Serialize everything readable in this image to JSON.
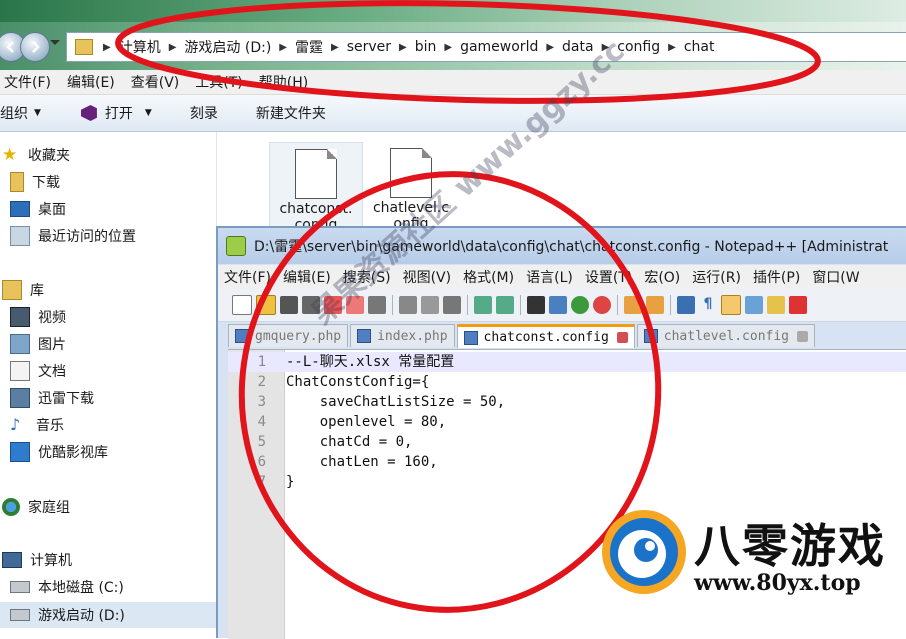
{
  "explorer": {
    "breadcrumb": [
      "计算机",
      "游戏启动 (D:)",
      "雷霆",
      "server",
      "bin",
      "gameworld",
      "data",
      "config",
      "chat"
    ],
    "menu": [
      "文件(F)",
      "编辑(E)",
      "查看(V)",
      "工具(T)",
      "帮助(H)"
    ],
    "toolbar": {
      "organize": "组织",
      "open": "打开",
      "burn": "刻录",
      "new_folder": "新建文件夹"
    },
    "sidebar": {
      "favorites": {
        "label": "收藏夹",
        "items": [
          "下载",
          "桌面",
          "最近访问的位置"
        ]
      },
      "libraries": {
        "label": "库",
        "items": [
          "视频",
          "图片",
          "文档",
          "迅雷下载",
          "音乐",
          "优酷影视库"
        ]
      },
      "homegroup": "家庭组",
      "computer": {
        "label": "计算机",
        "items": [
          "本地磁盘 (C:)",
          "游戏启动 (D:)"
        ]
      }
    },
    "files": [
      {
        "name": "chatconst.",
        "name2": "config"
      },
      {
        "name": "chatlevel.c",
        "name2": "onfig"
      }
    ]
  },
  "notepad": {
    "title": "D:\\雷霆\\server\\bin\\gameworld\\data\\config\\chat\\chatconst.config - Notepad++ [Administrat",
    "menu": [
      "文件(F)",
      "编辑(E)",
      "搜索(S)",
      "视图(V)",
      "格式(M)",
      "语言(L)",
      "设置(T)",
      "宏(O)",
      "运行(R)",
      "插件(P)",
      "窗口(W"
    ],
    "tabs": [
      {
        "label": "gmquery.php",
        "active": false
      },
      {
        "label": "index.php",
        "active": false
      },
      {
        "label": "chatconst.config",
        "active": true
      },
      {
        "label": "chatlevel.config",
        "active": false
      }
    ],
    "lines": [
      "--L-聊天.xlsx 常量配置",
      "ChatConstConfig={",
      "    saveChatListSize = 50,",
      "    openlevel = 80,",
      "    chatCd = 0,",
      "    chatLen = 160,",
      "}"
    ],
    "line_numbers": [
      "1",
      "2",
      "3",
      "4",
      "5",
      "6",
      "7"
    ]
  },
  "branding": {
    "title": "八零游戏",
    "url": "www.80yx.top",
    "watermark": "果果资源社区 www.ggzy.cc"
  },
  "colors": {
    "annotation_red": "#e0141a",
    "tab_accent": "#f39c12",
    "logo_blue": "#1a73c9",
    "logo_orange": "#f5a623"
  },
  "icons": [
    "back-arrow-icon",
    "forward-arrow-icon",
    "folder-icon",
    "star-icon",
    "monitor-icon",
    "save-icon",
    "close-icon",
    "config-file-icon"
  ]
}
